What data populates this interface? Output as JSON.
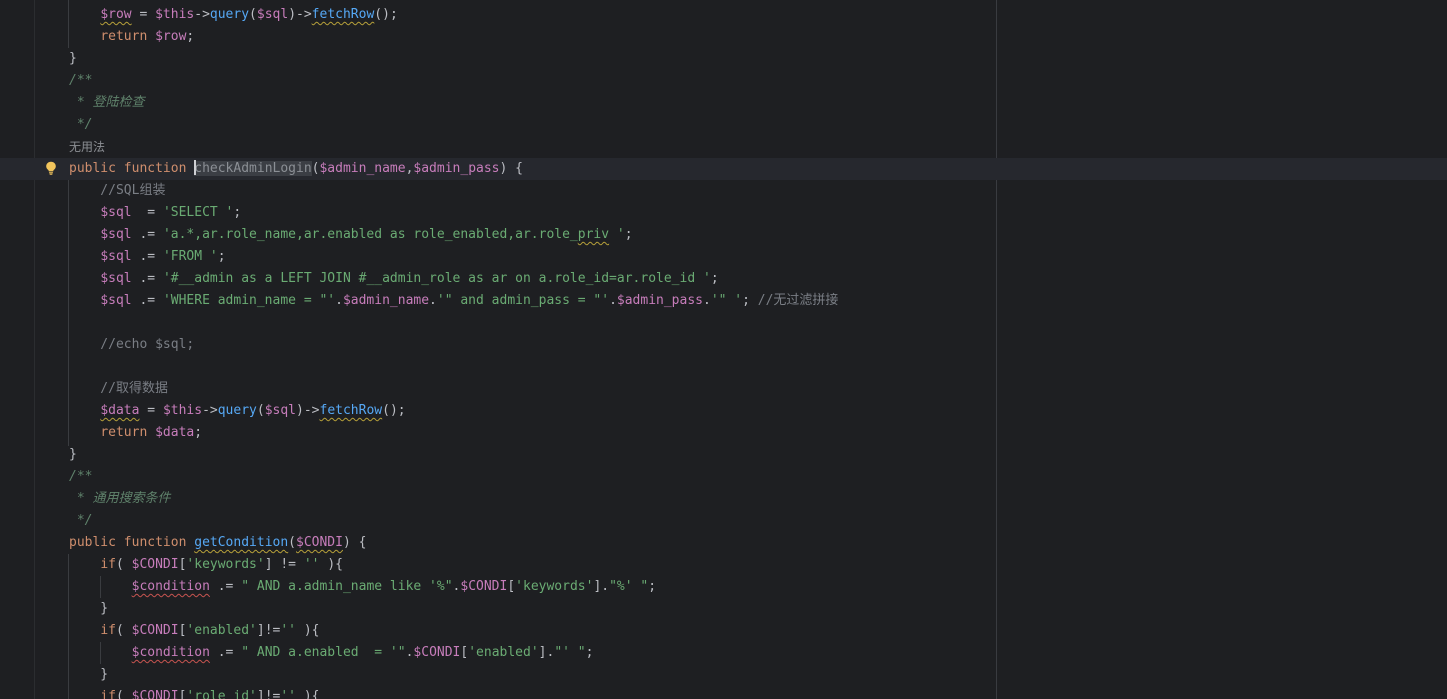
{
  "editor": {
    "hint_label": "无用法",
    "lines": [
      [
        {
          "t": "    ",
          "c": "punc"
        },
        {
          "t": "$row",
          "c": "var squig-y"
        },
        {
          "t": " = ",
          "c": "punc"
        },
        {
          "t": "$this",
          "c": "var"
        },
        {
          "t": "->",
          "c": "punc"
        },
        {
          "t": "query",
          "c": "fn"
        },
        {
          "t": "(",
          "c": "punc"
        },
        {
          "t": "$sql",
          "c": "var"
        },
        {
          "t": ")->",
          "c": "punc"
        },
        {
          "t": "fetchRow",
          "c": "fn squig-y"
        },
        {
          "t": "();",
          "c": "punc"
        }
      ],
      [
        {
          "t": "    ",
          "c": "punc"
        },
        {
          "t": "return",
          "c": "kw"
        },
        {
          "t": " ",
          "c": "punc"
        },
        {
          "t": "$row",
          "c": "var"
        },
        {
          "t": ";",
          "c": "punc"
        }
      ],
      [
        {
          "t": "}",
          "c": "punc"
        }
      ],
      [
        {
          "t": "/**",
          "c": "doc"
        }
      ],
      [
        {
          "t": " * 登陆检查",
          "c": "doc"
        }
      ],
      [
        {
          "t": " */",
          "c": "doc"
        }
      ],
      [
        {
          "t": "无用法",
          "c": "hint"
        }
      ],
      [
        {
          "t": "public",
          "c": "kw"
        },
        {
          "t": " ",
          "c": "punc"
        },
        {
          "t": "function",
          "c": "kw"
        },
        {
          "t": " ",
          "c": "punc"
        },
        {
          "t": "CARET",
          "c": "caret"
        },
        {
          "t": "checkAdminLogin",
          "c": "sel-fn"
        },
        {
          "t": "(",
          "c": "punc"
        },
        {
          "t": "$admin_name",
          "c": "var"
        },
        {
          "t": ",",
          "c": "punc"
        },
        {
          "t": "$admin_pass",
          "c": "var"
        },
        {
          "t": ") {",
          "c": "punc"
        }
      ],
      [
        {
          "t": "    //SQL组装",
          "c": "cmt"
        }
      ],
      [
        {
          "t": "    ",
          "c": "punc"
        },
        {
          "t": "$sql",
          "c": "var"
        },
        {
          "t": "  = ",
          "c": "punc"
        },
        {
          "t": "'SELECT '",
          "c": "str"
        },
        {
          "t": ";",
          "c": "punc"
        }
      ],
      [
        {
          "t": "    ",
          "c": "punc"
        },
        {
          "t": "$sql",
          "c": "var"
        },
        {
          "t": " .= ",
          "c": "punc"
        },
        {
          "t": "'a.*,ar.role_name,ar.enabled as role_enabled,ar.role_",
          "c": "str"
        },
        {
          "t": "priv",
          "c": "str squig-y"
        },
        {
          "t": " '",
          "c": "str"
        },
        {
          "t": ";",
          "c": "punc"
        }
      ],
      [
        {
          "t": "    ",
          "c": "punc"
        },
        {
          "t": "$sql",
          "c": "var"
        },
        {
          "t": " .= ",
          "c": "punc"
        },
        {
          "t": "'FROM '",
          "c": "str"
        },
        {
          "t": ";",
          "c": "punc"
        }
      ],
      [
        {
          "t": "    ",
          "c": "punc"
        },
        {
          "t": "$sql",
          "c": "var"
        },
        {
          "t": " .= ",
          "c": "punc"
        },
        {
          "t": "'#__admin as a LEFT JOIN #__admin_role as ar on a.role_id=ar.role_id '",
          "c": "str"
        },
        {
          "t": ";",
          "c": "punc"
        }
      ],
      [
        {
          "t": "    ",
          "c": "punc"
        },
        {
          "t": "$sql",
          "c": "var"
        },
        {
          "t": " .= ",
          "c": "punc"
        },
        {
          "t": "'WHERE admin_name = \"'",
          "c": "str"
        },
        {
          "t": ".",
          "c": "punc"
        },
        {
          "t": "$admin_name",
          "c": "var"
        },
        {
          "t": ".",
          "c": "punc"
        },
        {
          "t": "'\" and admin_pass = \"'",
          "c": "str"
        },
        {
          "t": ".",
          "c": "punc"
        },
        {
          "t": "$admin_pass",
          "c": "var"
        },
        {
          "t": ".",
          "c": "punc"
        },
        {
          "t": "'\" '",
          "c": "str"
        },
        {
          "t": "; ",
          "c": "punc"
        },
        {
          "t": "//无过滤拼接",
          "c": "cmt"
        }
      ],
      [],
      [
        {
          "t": "    //echo $sql;",
          "c": "cmt"
        }
      ],
      [],
      [
        {
          "t": "    //取得数据",
          "c": "cmt"
        }
      ],
      [
        {
          "t": "    ",
          "c": "punc"
        },
        {
          "t": "$data",
          "c": "var squig-y"
        },
        {
          "t": " = ",
          "c": "punc"
        },
        {
          "t": "$this",
          "c": "var"
        },
        {
          "t": "->",
          "c": "punc"
        },
        {
          "t": "query",
          "c": "fn"
        },
        {
          "t": "(",
          "c": "punc"
        },
        {
          "t": "$sql",
          "c": "var"
        },
        {
          "t": ")->",
          "c": "punc"
        },
        {
          "t": "fetchRow",
          "c": "fn squig-y"
        },
        {
          "t": "();",
          "c": "punc"
        }
      ],
      [
        {
          "t": "    ",
          "c": "punc"
        },
        {
          "t": "return",
          "c": "kw"
        },
        {
          "t": " ",
          "c": "punc"
        },
        {
          "t": "$data",
          "c": "var"
        },
        {
          "t": ";",
          "c": "punc"
        }
      ],
      [
        {
          "t": "}",
          "c": "punc"
        }
      ],
      [
        {
          "t": "/**",
          "c": "doc"
        }
      ],
      [
        {
          "t": " * 通用搜索条件",
          "c": "doc"
        }
      ],
      [
        {
          "t": " */",
          "c": "doc"
        }
      ],
      [
        {
          "t": "public",
          "c": "kw"
        },
        {
          "t": " ",
          "c": "punc"
        },
        {
          "t": "function",
          "c": "kw"
        },
        {
          "t": " ",
          "c": "punc"
        },
        {
          "t": "getCondition",
          "c": "fn squig-y"
        },
        {
          "t": "(",
          "c": "punc"
        },
        {
          "t": "$CONDI",
          "c": "var squig-y"
        },
        {
          "t": ") {",
          "c": "punc"
        }
      ],
      [
        {
          "t": "    ",
          "c": "punc"
        },
        {
          "t": "if",
          "c": "kw"
        },
        {
          "t": "( ",
          "c": "punc"
        },
        {
          "t": "$CONDI",
          "c": "var"
        },
        {
          "t": "[",
          "c": "punc"
        },
        {
          "t": "'keywords'",
          "c": "str"
        },
        {
          "t": "] != ",
          "c": "punc"
        },
        {
          "t": "''",
          "c": "str"
        },
        {
          "t": " ){",
          "c": "punc"
        }
      ],
      [
        {
          "t": "        ",
          "c": "punc"
        },
        {
          "t": "$condition",
          "c": "var squig-r"
        },
        {
          "t": " .= ",
          "c": "punc"
        },
        {
          "t": "\" AND a.admin_name like '%\"",
          "c": "str"
        },
        {
          "t": ".",
          "c": "punc"
        },
        {
          "t": "$CONDI",
          "c": "var"
        },
        {
          "t": "[",
          "c": "punc"
        },
        {
          "t": "'keywords'",
          "c": "str"
        },
        {
          "t": "].",
          "c": "punc"
        },
        {
          "t": "\"%' \"",
          "c": "str"
        },
        {
          "t": ";",
          "c": "punc"
        }
      ],
      [
        {
          "t": "    }",
          "c": "punc"
        }
      ],
      [
        {
          "t": "    ",
          "c": "punc"
        },
        {
          "t": "if",
          "c": "kw"
        },
        {
          "t": "( ",
          "c": "punc"
        },
        {
          "t": "$CONDI",
          "c": "var"
        },
        {
          "t": "[",
          "c": "punc"
        },
        {
          "t": "'enabled'",
          "c": "str"
        },
        {
          "t": "]!=",
          "c": "punc"
        },
        {
          "t": "''",
          "c": "str"
        },
        {
          "t": " ){",
          "c": "punc"
        }
      ],
      [
        {
          "t": "        ",
          "c": "punc"
        },
        {
          "t": "$condition",
          "c": "var squig-r"
        },
        {
          "t": " .= ",
          "c": "punc"
        },
        {
          "t": "\" AND a.enabled  = '\"",
          "c": "str"
        },
        {
          "t": ".",
          "c": "punc"
        },
        {
          "t": "$CONDI",
          "c": "var"
        },
        {
          "t": "[",
          "c": "punc"
        },
        {
          "t": "'enabled'",
          "c": "str"
        },
        {
          "t": "].",
          "c": "punc"
        },
        {
          "t": "\"' \"",
          "c": "str"
        },
        {
          "t": ";",
          "c": "punc"
        }
      ],
      [
        {
          "t": "    }",
          "c": "punc"
        }
      ],
      [
        {
          "t": "    ",
          "c": "punc"
        },
        {
          "t": "if",
          "c": "kw"
        },
        {
          "t": "( ",
          "c": "punc"
        },
        {
          "t": "$CONDI",
          "c": "var"
        },
        {
          "t": "[",
          "c": "punc"
        },
        {
          "t": "'role_id'",
          "c": "str"
        },
        {
          "t": "]!=",
          "c": "punc"
        },
        {
          "t": "''",
          "c": "str"
        },
        {
          "t": " ){",
          "c": "punc"
        }
      ]
    ]
  },
  "colors": {
    "background": "#1e1f22",
    "current_line": "#26282e",
    "keyword": "#cf8e6d",
    "variable": "#c77dbb",
    "function": "#56a8f5",
    "string": "#6aab73",
    "comment": "#7a7e85",
    "doc_comment": "#5f826b"
  },
  "icons": {
    "gutter_intention": "lightbulb-icon"
  }
}
